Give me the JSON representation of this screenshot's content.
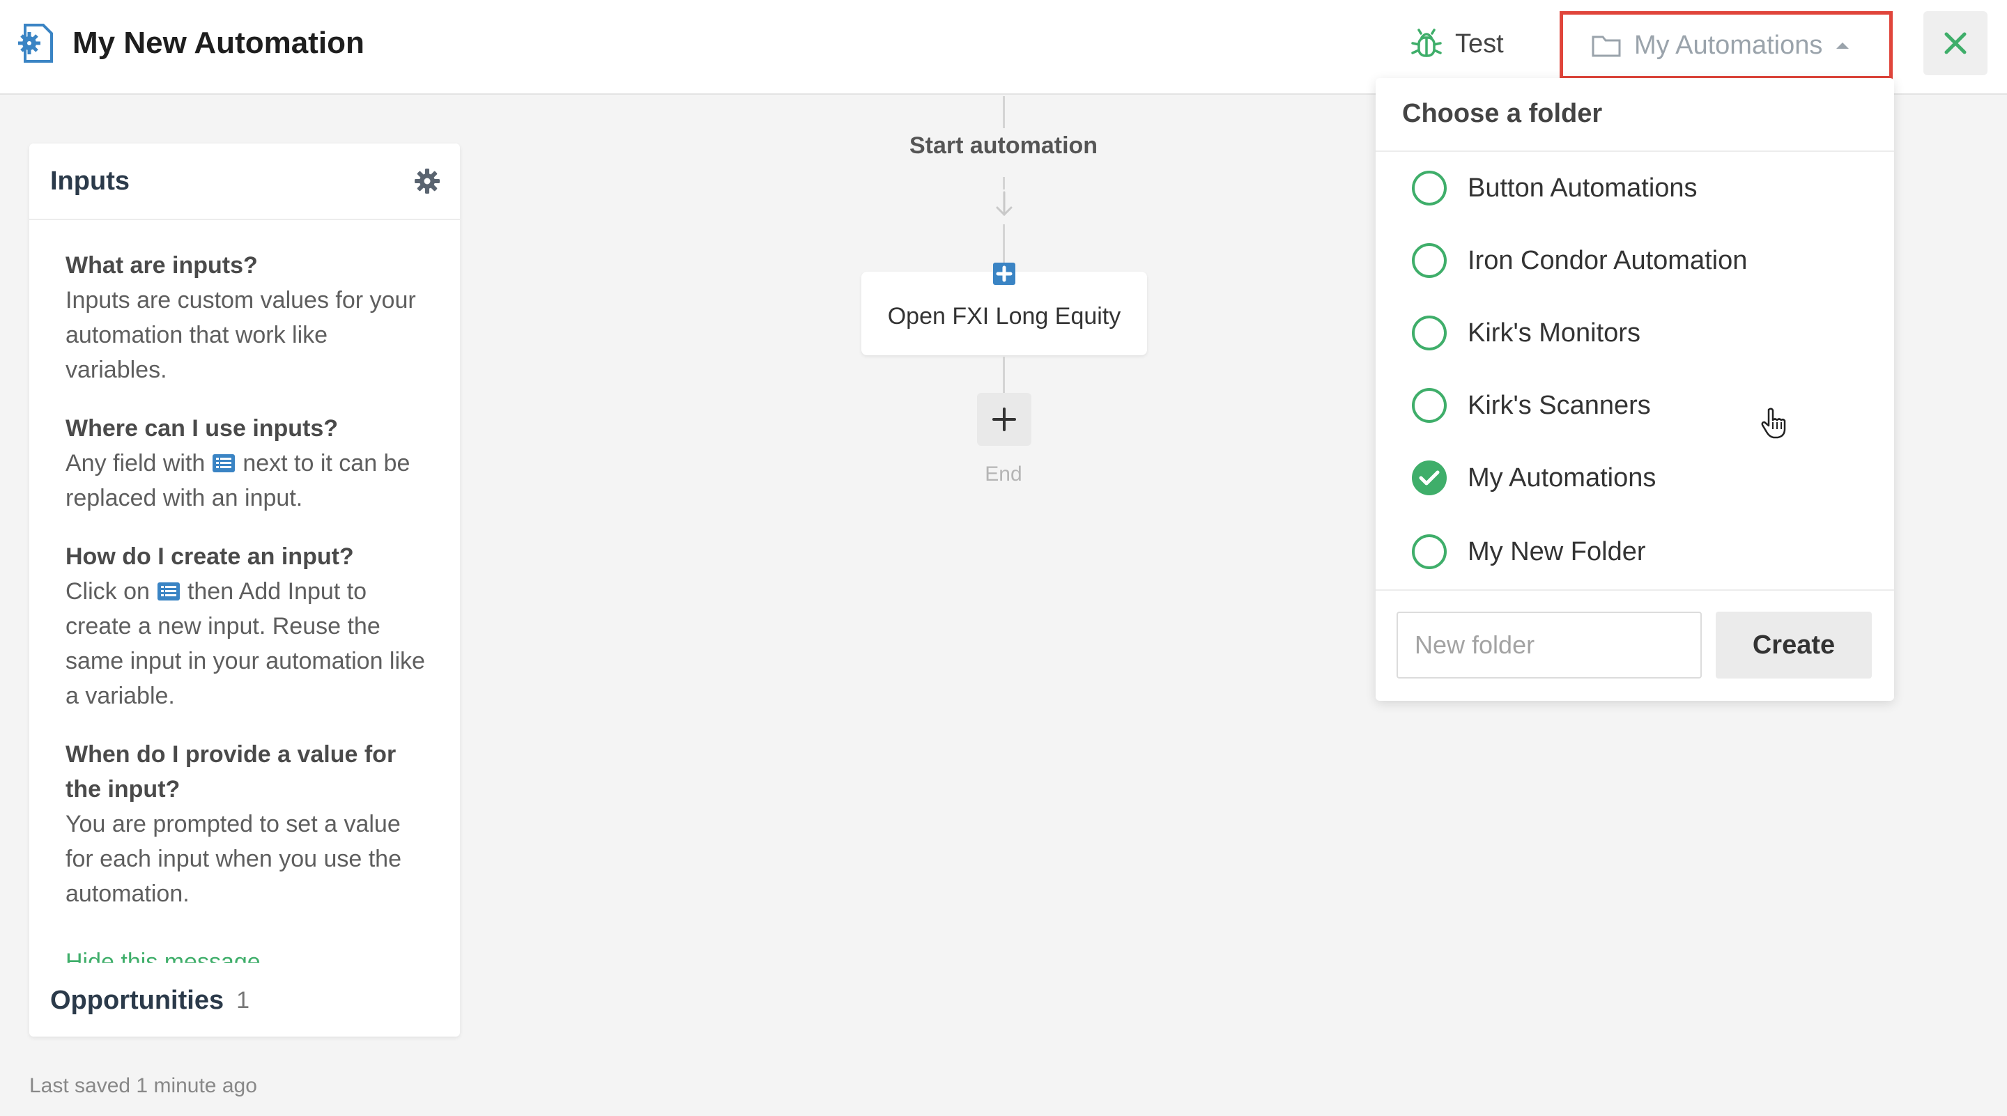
{
  "header": {
    "title": "My New Automation",
    "app_icon": "automation-gear-icon",
    "test_label": "Test",
    "test_icon": "bug-icon",
    "folder_selected": "My Automations",
    "folder_icon": "folder-icon",
    "close_icon": "close-icon",
    "accent_color": "#3fae6a",
    "highlight_color": "#e0453b"
  },
  "inputs_panel": {
    "title": "Inputs",
    "settings_icon": "gear-icon",
    "faq": [
      {
        "q": "What are inputs?",
        "a": "Inputs are custom values for your automation that work like variables."
      },
      {
        "q": "Where can I use inputs?",
        "a_before": "Any field with",
        "a_after": "next to it can be replaced with an input."
      },
      {
        "q": "How do I create an input?",
        "a_before": "Click on",
        "a_after": "then Add Input to create a new input. Reuse the same input in your automation like a variable."
      },
      {
        "q": "When do I provide a value for the input?",
        "a": "You are prompted to set a value for each input when you use the automation."
      }
    ],
    "hide_message": "Hide this message",
    "opportunities_label": "Opportunities",
    "opportunities_count": "1"
  },
  "flow": {
    "start_label": "Start automation",
    "node_label": "Open FXI Long Equity",
    "end_label": "End"
  },
  "folder_menu": {
    "title": "Choose a folder",
    "options": [
      {
        "label": "Button Automations",
        "checked": false
      },
      {
        "label": "Iron Condor Automation",
        "checked": false
      },
      {
        "label": "Kirk's Monitors",
        "checked": false
      },
      {
        "label": "Kirk's Scanners",
        "checked": false
      },
      {
        "label": "My Automations",
        "checked": true
      },
      {
        "label": "My New Folder",
        "checked": false
      }
    ],
    "new_folder_placeholder": "New folder",
    "new_folder_value": "",
    "create_label": "Create"
  },
  "footer": {
    "last_saved": "Last saved 1 minute ago"
  }
}
